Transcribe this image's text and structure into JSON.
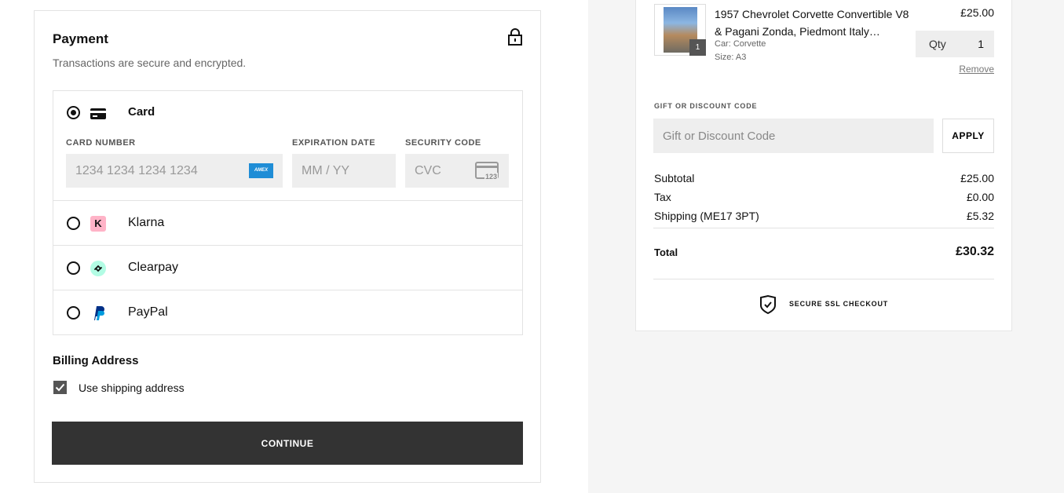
{
  "payment": {
    "title": "Payment",
    "subtitle": "Transactions are secure and encrypted.",
    "methods": [
      {
        "label": "Card",
        "selected": true,
        "icon": "card-icon"
      },
      {
        "label": "Klarna",
        "selected": false,
        "icon": "klarna-icon"
      },
      {
        "label": "Clearpay",
        "selected": false,
        "icon": "clearpay-icon"
      },
      {
        "label": "PayPal",
        "selected": false,
        "icon": "paypal-icon"
      }
    ],
    "card": {
      "number_label": "CARD NUMBER",
      "number_placeholder": "1234 1234 1234 1234",
      "expiry_label": "EXPIRATION DATE",
      "expiry_placeholder": "MM / YY",
      "cvc_label": "SECURITY CODE",
      "cvc_placeholder": "CVC",
      "cvc_hint": "123",
      "brand": "AMEX"
    },
    "billing_title": "Billing Address",
    "use_shipping_label": "Use shipping address",
    "use_shipping_checked": true,
    "continue_label": "CONTINUE"
  },
  "summary": {
    "item": {
      "name": "1957 Chevrolet Corvette Convertible V8 & Pagani Zonda, Piedmont Italy…",
      "car": "Car: Corvette",
      "size": "Size: A3",
      "price": "£25.00",
      "qty_label": "Qty",
      "qty": "1",
      "badge": "1",
      "remove_label": "Remove"
    },
    "gift_label": "GIFT OR DISCOUNT CODE",
    "gift_placeholder": "Gift or Discount Code",
    "apply_label": "APPLY",
    "subtotal_label": "Subtotal",
    "subtotal": "£25.00",
    "tax_label": "Tax",
    "tax": "£0.00",
    "shipping_label": "Shipping (ME17 3PT)",
    "shipping": "£5.32",
    "total_label": "Total",
    "total": "£30.32",
    "ssl_label": "SECURE SSL CHECKOUT"
  },
  "colors": {
    "button_dark": "#333333",
    "field_bg": "#eeeeee",
    "right_bg": "#f5f5f5",
    "amex_blue": "#1f8dd6",
    "klarna_pink": "#ffb3c7",
    "clearpay_mint": "#b2fce4",
    "paypal_blue": "#003087"
  }
}
